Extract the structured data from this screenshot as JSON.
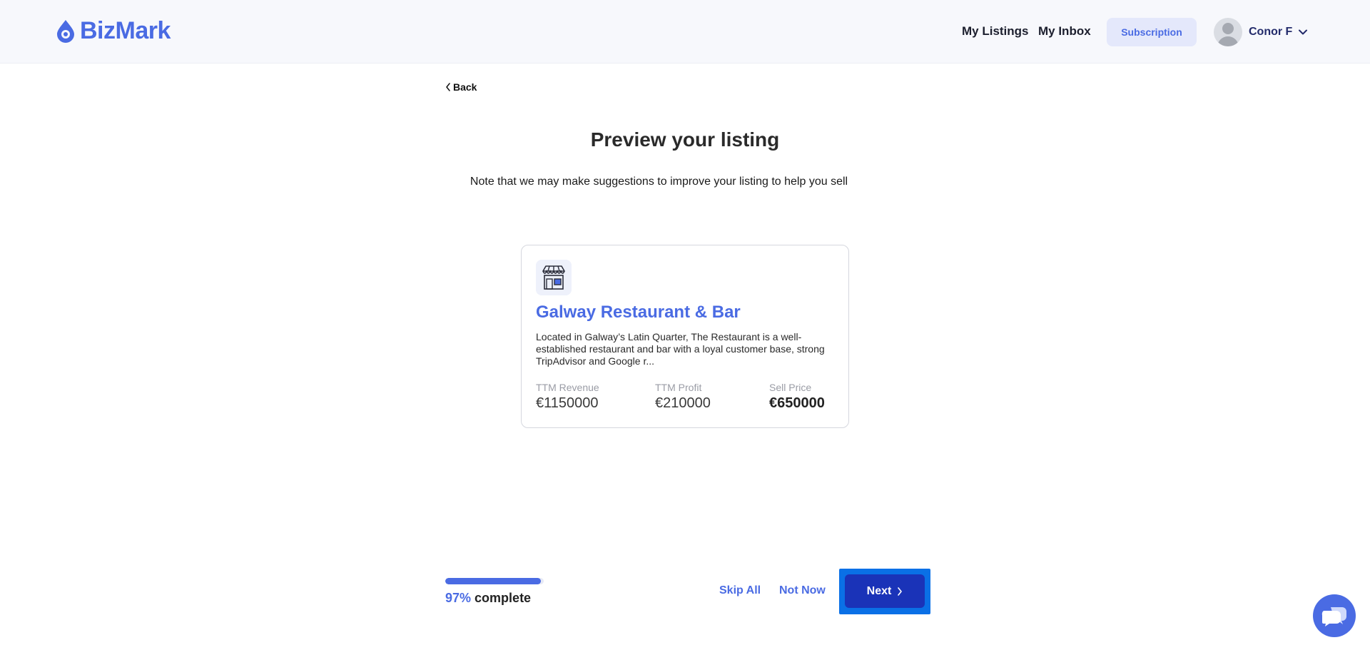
{
  "header": {
    "brand": "BizMark",
    "nav": {
      "my_listings": "My Listings",
      "my_inbox": "My Inbox",
      "subscription": "Subscription"
    },
    "user": {
      "name": "Conor F"
    }
  },
  "page": {
    "back_label": "Back",
    "title": "Preview your listing",
    "note": "Note that we may make suggestions to improve your listing to help you sell"
  },
  "listing": {
    "title": "Galway Restaurant & Bar",
    "description": "Located in Galway’s Latin Quarter, The Restaurant is a well-established restaurant and bar with a loyal customer base, strong TripAdvisor and Google r...",
    "metrics": {
      "revenue_label": "TTM Revenue",
      "revenue_value": "€1150000",
      "profit_label": "TTM Profit",
      "profit_value": "€210000",
      "price_label": "Sell Price",
      "price_value": "€650000"
    }
  },
  "progress": {
    "percent_text": "97%",
    "suffix": "complete",
    "fraction": 0.97
  },
  "actions": {
    "skip_all": "Skip All",
    "not_now": "Not Now",
    "next": "Next"
  },
  "icons": {
    "logo": "droplet-logo-icon",
    "avatar": "user-avatar-icon",
    "user_menu": "chevron-down-icon",
    "back": "chevron-left-icon",
    "listing": "storefront-icon",
    "next": "chevron-right-icon",
    "chat": "chat-bubbles-icon"
  },
  "colors": {
    "brand": "#4a6be3",
    "primary_button": "#1a33b8",
    "focus_ring": "#0a70e6",
    "subscription_bg": "#e4e8fb"
  }
}
